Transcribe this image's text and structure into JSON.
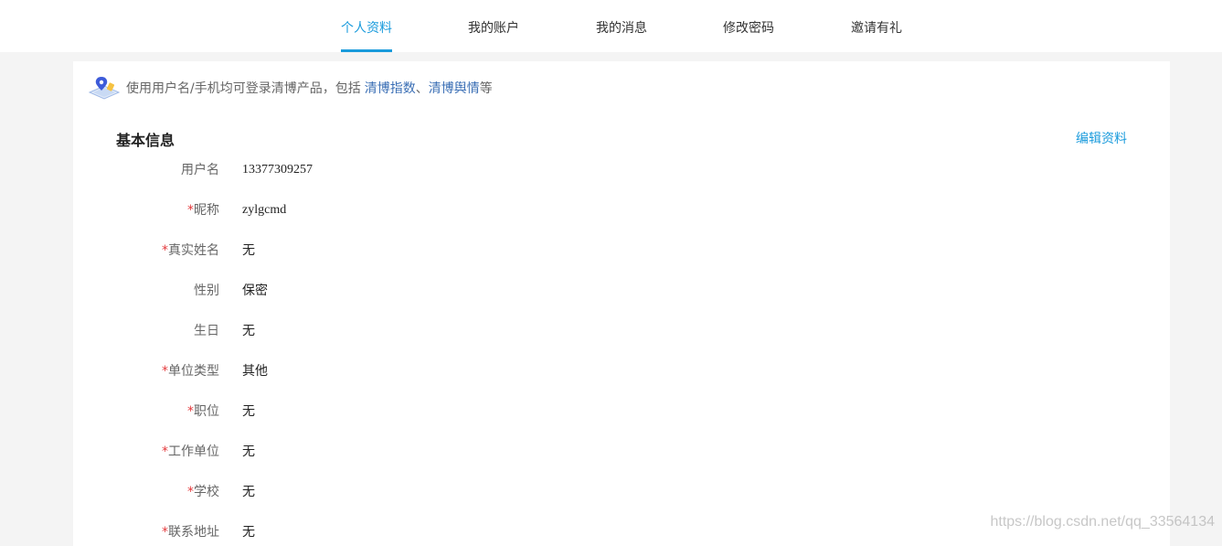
{
  "tabs": [
    {
      "label": "个人资料",
      "active": true
    },
    {
      "label": "我的账户",
      "active": false
    },
    {
      "label": "我的消息",
      "active": false
    },
    {
      "label": "修改密码",
      "active": false
    },
    {
      "label": "邀请有礼",
      "active": false
    }
  ],
  "notice": {
    "icon": "map-pin-icon",
    "text": "使用用户名/手机均可登录清博产品，包括",
    "link1": "清博指数",
    "sep": "、",
    "link2": "清博舆情",
    "suffix": "等"
  },
  "section": {
    "title": "基本信息",
    "edit_label": "编辑资料"
  },
  "fields": [
    {
      "label": "用户名",
      "required": false,
      "value": "13377309257"
    },
    {
      "label": "昵称",
      "required": true,
      "value": "zylgcmd"
    },
    {
      "label": "真实姓名",
      "required": true,
      "value": "无"
    },
    {
      "label": "性别",
      "required": false,
      "value": "保密"
    },
    {
      "label": "生日",
      "required": false,
      "value": "无"
    },
    {
      "label": "单位类型",
      "required": true,
      "value": "其他"
    },
    {
      "label": "职位",
      "required": true,
      "value": "无"
    },
    {
      "label": "工作单位",
      "required": true,
      "value": "无"
    },
    {
      "label": "学校",
      "required": true,
      "value": "无"
    },
    {
      "label": "联系地址",
      "required": true,
      "value": "无"
    }
  ],
  "required_mark": "*",
  "watermark": "https://blog.csdn.net/qq_33564134",
  "colors": {
    "accent": "#1a9bdc",
    "required": "#e4393c",
    "link": "#3b6fb5"
  }
}
